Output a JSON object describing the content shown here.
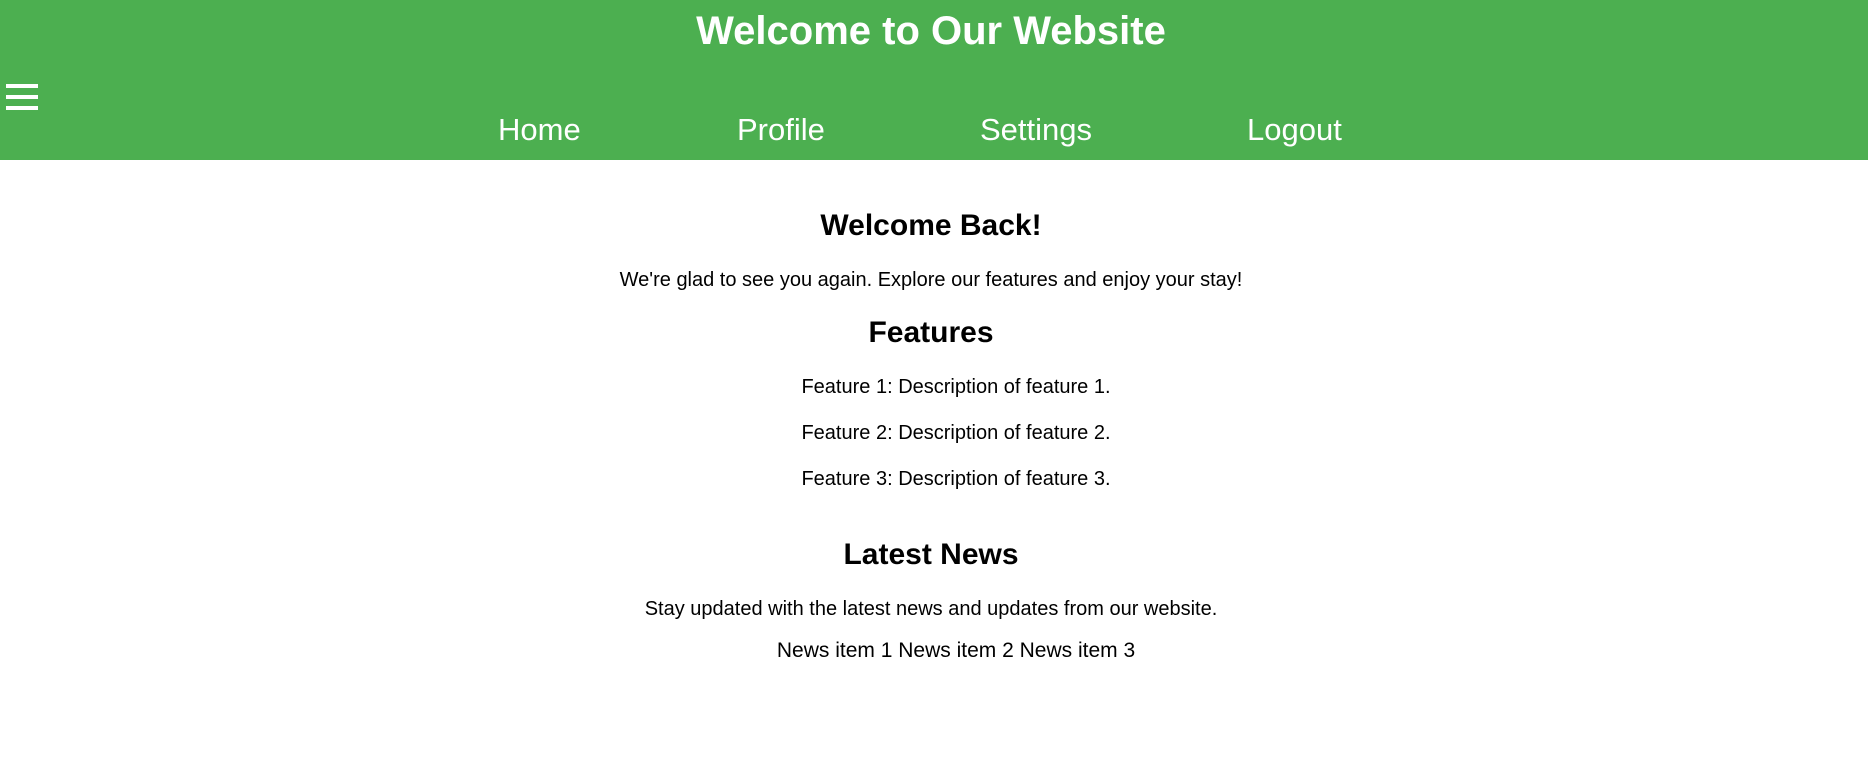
{
  "header": {
    "title": "Welcome to Our Website",
    "menu_icon": "hamburger-menu-icon",
    "background_color": "#4caf50",
    "text_color": "#ffffff"
  },
  "nav": {
    "items": [
      {
        "label": "Home"
      },
      {
        "label": "Profile"
      },
      {
        "label": "Settings"
      },
      {
        "label": "Logout"
      }
    ]
  },
  "welcome": {
    "heading": "Welcome Back!",
    "text": "We're glad to see you again. Explore our features and enjoy your stay!"
  },
  "features": {
    "heading": "Features",
    "items": [
      "Feature 1: Description of feature 1.",
      "Feature 2: Description of feature 2.",
      "Feature 3: Description of feature 3."
    ]
  },
  "news": {
    "heading": "Latest News",
    "text": "Stay updated with the latest news and updates from our website.",
    "items": [
      "News item 1",
      "News item 2",
      "News item 3"
    ]
  }
}
